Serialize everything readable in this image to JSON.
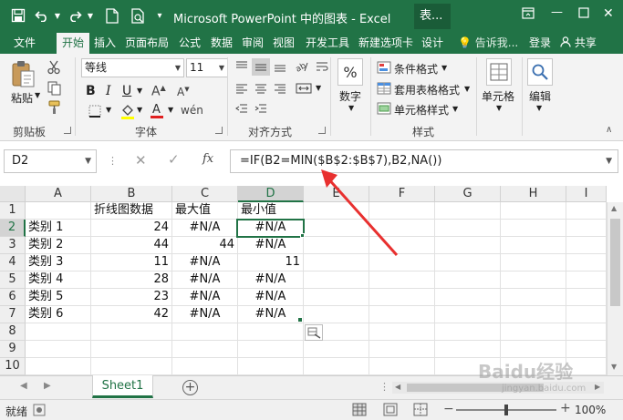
{
  "window": {
    "title": "Microsoft PowerPoint 中的图表 - Excel",
    "context_tab": "表..."
  },
  "tabs": [
    {
      "label": "文件",
      "active": false
    },
    {
      "label": "开始",
      "active": true
    },
    {
      "label": "插入",
      "active": false
    },
    {
      "label": "页面布局",
      "active": false
    },
    {
      "label": "公式",
      "active": false
    },
    {
      "label": "数据",
      "active": false
    },
    {
      "label": "审阅",
      "active": false
    },
    {
      "label": "视图",
      "active": false
    },
    {
      "label": "开发工具",
      "active": false
    },
    {
      "label": "新建选项卡",
      "active": false
    },
    {
      "label": "设计",
      "active": false
    }
  ],
  "tell_me": "告诉我...",
  "login": "登录",
  "share": "共享",
  "ribbon": {
    "clipboard": {
      "paste": "粘贴",
      "label": "剪贴板"
    },
    "font": {
      "name": "等线",
      "size": "11",
      "label": "字体"
    },
    "alignment": {
      "label": "对齐方式"
    },
    "number": {
      "button": "数字"
    },
    "styles": {
      "conditional": "条件格式",
      "table_format": "套用表格格式",
      "cell_styles": "单元格样式",
      "label": "样式"
    },
    "cells": {
      "button": "单元格"
    },
    "editing": {
      "button": "编辑"
    }
  },
  "formula_bar": {
    "name_box": "D2",
    "fx": "fx",
    "formula": "=IF(B2=MIN($B$2:$B$7),B2,NA())"
  },
  "sheet": {
    "columns": [
      "A",
      "B",
      "C",
      "D",
      "E",
      "F",
      "G",
      "H",
      "I"
    ],
    "selected_column": "D",
    "selected_row": "2",
    "rows": [
      {
        "num": "1",
        "a": "",
        "b": "折线图数据",
        "c": "最大值",
        "d": "最小值"
      },
      {
        "num": "2",
        "a": "类别 1",
        "b": "24",
        "c": "#N/A",
        "d": "#N/A"
      },
      {
        "num": "3",
        "a": "类别 2",
        "b": "44",
        "c": "44",
        "d": "#N/A"
      },
      {
        "num": "4",
        "a": "类别 3",
        "b": "11",
        "c": "#N/A",
        "d": "11"
      },
      {
        "num": "5",
        "a": "类别 4",
        "b": "28",
        "c": "#N/A",
        "d": "#N/A"
      },
      {
        "num": "6",
        "a": "类别 5",
        "b": "23",
        "c": "#N/A",
        "d": "#N/A"
      },
      {
        "num": "7",
        "a": "类别 6",
        "b": "42",
        "c": "#N/A",
        "d": "#N/A"
      },
      {
        "num": "8",
        "a": "",
        "b": "",
        "c": "",
        "d": ""
      },
      {
        "num": "9",
        "a": "",
        "b": "",
        "c": "",
        "d": ""
      },
      {
        "num": "10",
        "a": "",
        "b": "",
        "c": "",
        "d": ""
      }
    ]
  },
  "sheet_tabs": [
    {
      "label": "Sheet1",
      "active": true
    }
  ],
  "status": {
    "ready": "就绪",
    "zoom": "100%"
  },
  "watermark": {
    "brand": "Baidu经验",
    "url": "jingyan.baidu.com"
  },
  "colors": {
    "accent": "#217346",
    "arrow": "#e8302f"
  }
}
